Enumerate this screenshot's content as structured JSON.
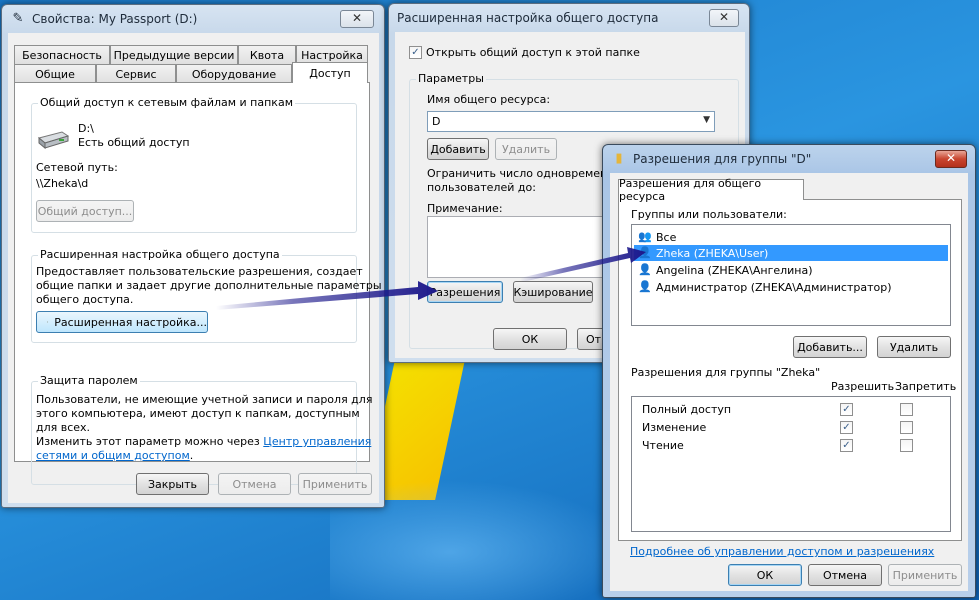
{
  "props_window": {
    "title": "Свойства: My Passport (D:)",
    "close": "✕",
    "tabs_row1": [
      "Безопасность",
      "Предыдущие версии",
      "Квота",
      "Настройка"
    ],
    "tabs_row2": [
      "Общие",
      "Сервис",
      "Оборудование",
      "Доступ"
    ],
    "network_share": {
      "title": "Общий доступ к сетевым файлам и папкам",
      "drive_path": "D:\\",
      "status": "Есть общий доступ",
      "net_path_label": "Сетевой путь:",
      "net_path_value": "\\\\Zheka\\d",
      "share_button": "Общий доступ..."
    },
    "advanced": {
      "title": "Расширенная настройка общего доступа",
      "line1": "Предоставляет пользовательские разрешения, создает",
      "line2": "общие папки и задает другие дополнительные параметры",
      "line3": "общего доступа.",
      "button": "Расширенная настройка..."
    },
    "password": {
      "title": "Защита паролем",
      "line1": "Пользователи, не имеющие учетной записи и пароля для",
      "line2": "этого компьютера, имеют доступ к папкам, доступным",
      "line3": "для всех.",
      "line4": "Изменить этот параметр можно через",
      "link1": "Центр управления",
      "link2": "сетями и общим доступом",
      "link_end": "."
    },
    "buttons": {
      "close": "Закрыть",
      "cancel": "Отмена",
      "apply": "Применить"
    }
  },
  "adv_window": {
    "title": "Расширенная настройка общего доступа",
    "close": "✕",
    "share_checkbox": "Открыть общий доступ к этой папке",
    "params_label": "Параметры",
    "share_name_label": "Имя общего ресурса:",
    "share_name_value": "D",
    "add": "Добавить",
    "remove": "Удалить",
    "limit_line1": "Ограничить число одновременных",
    "limit_line2": "пользователей до:",
    "note_label": "Примечание:",
    "permissions": "Разрешения",
    "caching": "Кэширование",
    "ok": "ОК",
    "cancel_partial": "От"
  },
  "perm_window": {
    "title": "Разрешения для группы \"D\"",
    "close": "✕",
    "tab": "Разрешения для общего ресурса",
    "groups_label": "Группы или пользователи:",
    "users": [
      "Все",
      "Zheka (ZHEKA\\User)",
      "Angelina (ZHEKA\\Ангелина)",
      "Администратор (ZHEKA\\Администратор)"
    ],
    "add": "Добавить...",
    "remove": "Удалить",
    "perm_for": "Разрешения для группы \"Zheka\"",
    "allow": "Разрешить",
    "deny": "Запретить",
    "perms": [
      "Полный доступ",
      "Изменение",
      "Чтение"
    ],
    "link": "Подробнее об управлении доступом и разрешениях",
    "ok": "ОК",
    "cancel": "Отмена",
    "apply": "Применить"
  },
  "colors": {
    "selection": "#3399ff",
    "arrow": "#1e1a8c",
    "link": "#0066cc"
  }
}
